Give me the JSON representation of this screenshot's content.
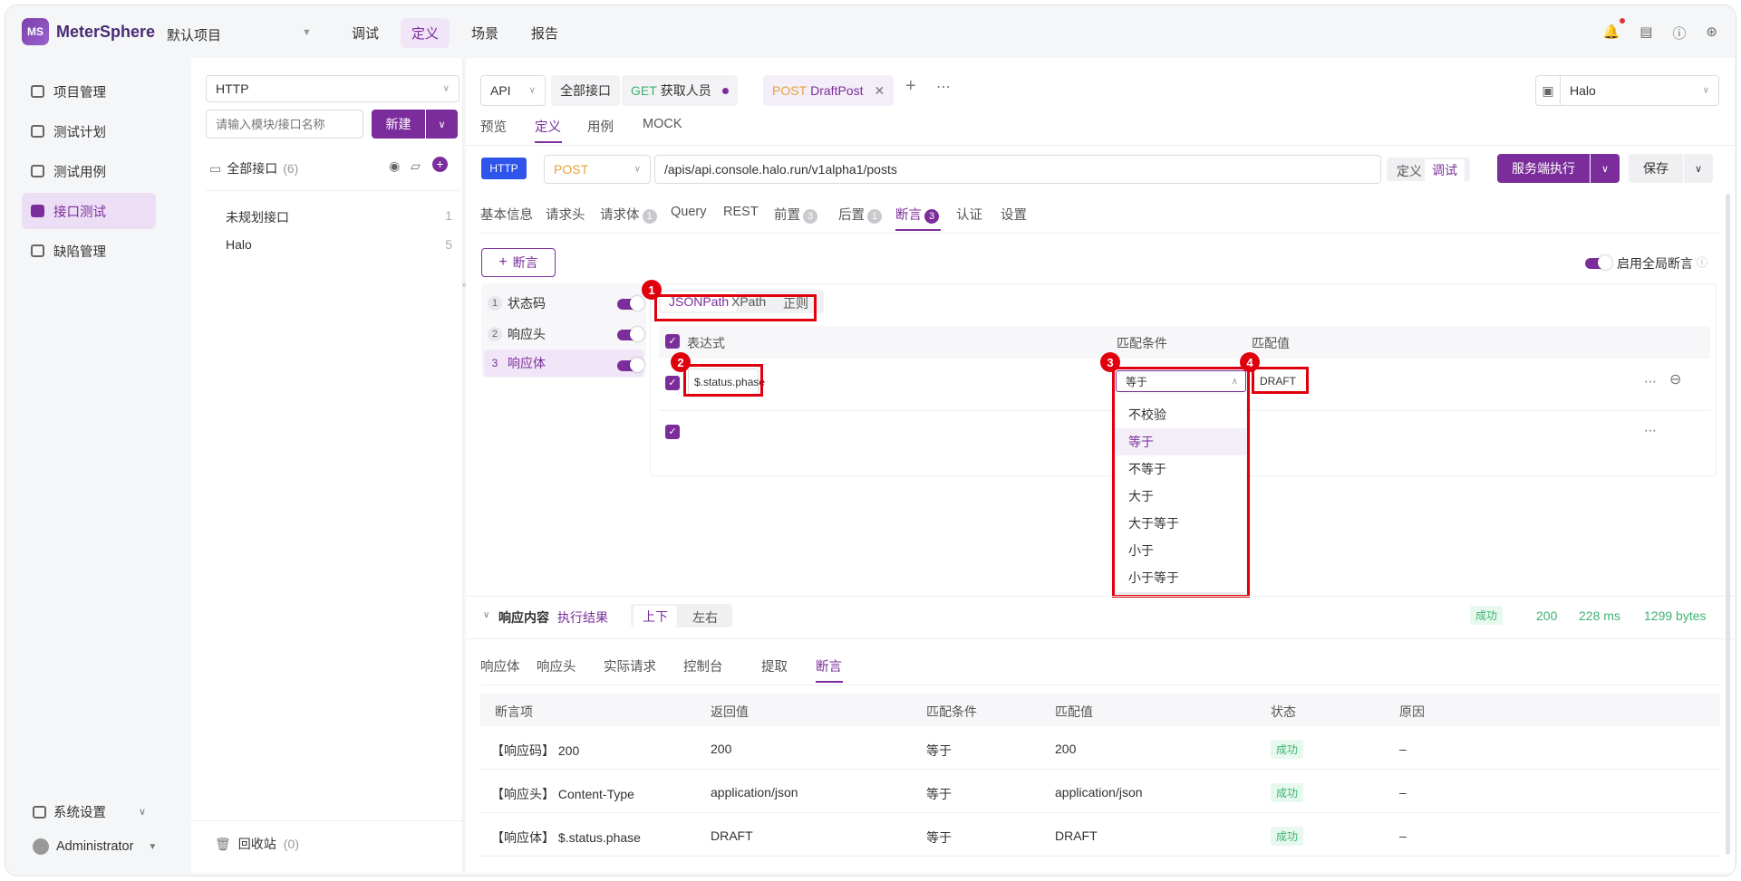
{
  "app": {
    "logo_mark": "MS",
    "name": "MeterSphere",
    "project": "默认项目"
  },
  "topnav": [
    "调试",
    "定义",
    "场景",
    "报告"
  ],
  "leftnav": {
    "items": [
      "项目管理",
      "测试计划",
      "测试用例",
      "接口测试",
      "缺陷管理"
    ],
    "settings": "系统设置",
    "user": "Administrator"
  },
  "tree": {
    "protocol": "HTTP",
    "search_placeholder": "请输入模块/接口名称",
    "new_label": "新建",
    "all_label": "全部接口",
    "all_count": "(6)",
    "modules": [
      {
        "name": "未规划接口",
        "count": "1"
      },
      {
        "name": "Halo",
        "count": "5"
      }
    ],
    "recycle_label": "回收站",
    "recycle_count": "(0)"
  },
  "api_tabs": {
    "type_select": "API",
    "all": "全部接口",
    "tab1_method": "GET",
    "tab1_name": "获取人员",
    "tab2_method": "POST",
    "tab2_name": "DraftPost",
    "env": "Halo"
  },
  "view_tabs": [
    "预览",
    "定义",
    "用例",
    "MOCK"
  ],
  "request": {
    "protocol_badge": "HTTP",
    "method": "POST",
    "url": "/apis/api.console.halo.run/v1alpha1/posts",
    "mode_define": "定义",
    "mode_debug": "调试",
    "run_label": "服务端执行",
    "save_label": "保存"
  },
  "req_tabs": [
    {
      "label": "基本信息",
      "badge": ""
    },
    {
      "label": "请求头",
      "badge": ""
    },
    {
      "label": "请求体",
      "badge": "1"
    },
    {
      "label": "Query",
      "badge": ""
    },
    {
      "label": "REST",
      "badge": ""
    },
    {
      "label": "前置",
      "badge": "3"
    },
    {
      "label": "后置",
      "badge": "1"
    },
    {
      "label": "断言",
      "badge": "3"
    },
    {
      "label": "认证",
      "badge": ""
    },
    {
      "label": "设置",
      "badge": ""
    }
  ],
  "assert_panel": {
    "add_label": "断言",
    "global_label": "启用全局断言",
    "list": [
      {
        "idx": "1",
        "name": "状态码"
      },
      {
        "idx": "2",
        "name": "响应头"
      },
      {
        "idx": "3",
        "name": "响应体"
      }
    ],
    "types": [
      "JSONPath",
      "XPath",
      "正则"
    ],
    "col_expr": "表达式",
    "col_cond": "匹配条件",
    "col_val": "匹配值",
    "row_expr": "$.status.phase",
    "row_cond": "等于",
    "row_val": "DRAFT",
    "dropdown": [
      "不校验",
      "等于",
      "不等于",
      "大于",
      "大于等于",
      "小于",
      "小于等于"
    ],
    "markers": [
      "1",
      "2",
      "3",
      "4"
    ]
  },
  "response": {
    "title": "响应内容",
    "result_label": "执行结果",
    "layout_updown": "上下",
    "layout_leftright": "左右",
    "status_tag": "成功",
    "code": "200",
    "time": "228 ms",
    "size": "1299 bytes",
    "tabs": [
      "响应体",
      "响应头",
      "实际请求",
      "控制台",
      "提取",
      "断言"
    ],
    "table_headers": [
      "断言项",
      "返回值",
      "匹配条件",
      "匹配值",
      "状态",
      "原因"
    ],
    "rows": [
      {
        "item": "【响应码】 200",
        "ret": "200",
        "cond": "等于",
        "val": "200",
        "status": "成功",
        "reason": "–"
      },
      {
        "item": "【响应头】 Content-Type",
        "ret": "application/json",
        "cond": "等于",
        "val": "application/json",
        "status": "成功",
        "reason": "–"
      },
      {
        "item": "【响应体】 $.status.phase",
        "ret": "DRAFT",
        "cond": "等于",
        "val": "DRAFT",
        "status": "成功",
        "reason": "–"
      }
    ]
  },
  "colors": {
    "brand": "#7b2e9b",
    "success": "#3cb371",
    "highlight": "#e0000d"
  }
}
